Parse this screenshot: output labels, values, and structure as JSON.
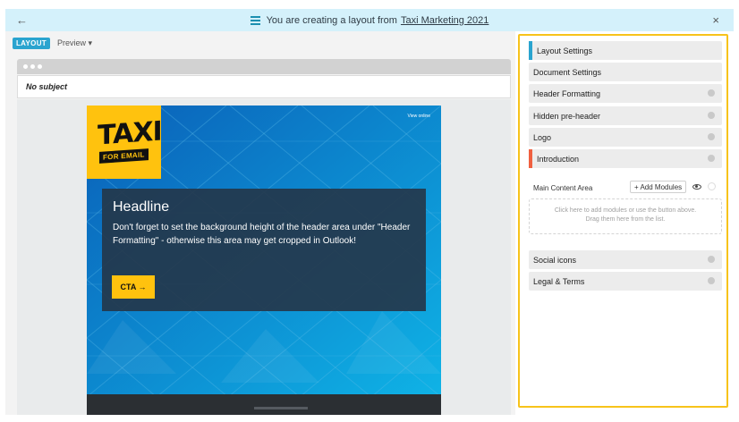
{
  "topbar": {
    "prefix": "You are creating a layout from",
    "layout_name": "Taxi Marketing 2021",
    "back_glyph": "←",
    "close_glyph": "×"
  },
  "modebar": {
    "layout_label": "LAYOUT",
    "preview_label": "Preview ▾"
  },
  "email": {
    "subject": "No subject",
    "logo_main": "TAXI",
    "logo_sub": "FOR EMAIL",
    "view_online": "View online",
    "headline": "Headline",
    "body": "Don't forget to set the background height of the header area under \"Header Formatting\" - otherwise this area may get cropped in Outlook!",
    "cta": "CTA →"
  },
  "sidebar": {
    "sections": [
      {
        "label": "Layout Settings",
        "accent": "#2aa4cf",
        "gear": false
      },
      {
        "label": "Document Settings",
        "accent": "",
        "gear": false
      },
      {
        "label": "Header Formatting",
        "accent": "",
        "gear": true
      },
      {
        "label": "Hidden pre-header",
        "accent": "",
        "gear": true
      },
      {
        "label": "Logo",
        "accent": "",
        "gear": true
      },
      {
        "label": "Introduction",
        "accent": "#f06040",
        "gear": true
      }
    ],
    "main_content_area": {
      "label": "Main Content Area",
      "add_modules": "+ Add Modules",
      "dropzone_text": "Click here to add modules or use the button above. Drag them here from the list."
    },
    "lower_sections": [
      {
        "label": "Social icons",
        "gear": true
      },
      {
        "label": "Legal & Terms",
        "gear": true
      }
    ]
  },
  "colors": {
    "topbar_bg": "#d4f1fb",
    "accent_blue": "#2aa4cf",
    "highlight_border": "#f7c31b",
    "taxi_yellow": "#ffc20e"
  }
}
